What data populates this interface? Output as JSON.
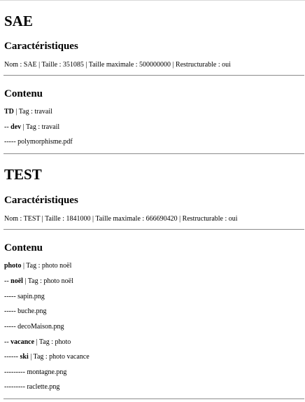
{
  "sae": {
    "title": "SAE",
    "characteristics_heading": "Caractéristiques",
    "details": "Nom : SAE | Taille : 351085 | Taille maximale : 500000000 | Restructurable : oui",
    "content_heading": "Contenu",
    "td_folder": {
      "prefix": "",
      "name": "TD",
      "suffix": " | Tag : travail"
    },
    "dev_folder": {
      "prefix": "-- ",
      "name": "dev",
      "suffix": " | Tag : travail"
    },
    "poly_file": "----- polymorphisme.pdf"
  },
  "test": {
    "title": "TEST",
    "characteristics_heading": "Caractéristiques",
    "details": "Nom : TEST | Taille : 1841000 | Taille maximale : 666690420 | Restructurable : oui",
    "content_heading": "Contenu",
    "photo_folder": {
      "prefix": "",
      "name": "photo",
      "suffix": " | Tag : photo noël"
    },
    "noel_folder": {
      "prefix": "-- ",
      "name": "noël",
      "suffix": " | Tag : photo noël"
    },
    "sapin_file": "----- sapin.png",
    "buche_file": "----- buche.png",
    "deco_file": "----- decoMaison.png",
    "vacance_folder": {
      "prefix": "-- ",
      "name": "vacance",
      "suffix": " | Tag : photo"
    },
    "ski_folder": {
      "prefix": "------ ",
      "name": "ski",
      "suffix": " | Tag : photo vacance"
    },
    "montagne_file": "--------- montagne.png",
    "raclette_file": "--------- raclette.png"
  }
}
